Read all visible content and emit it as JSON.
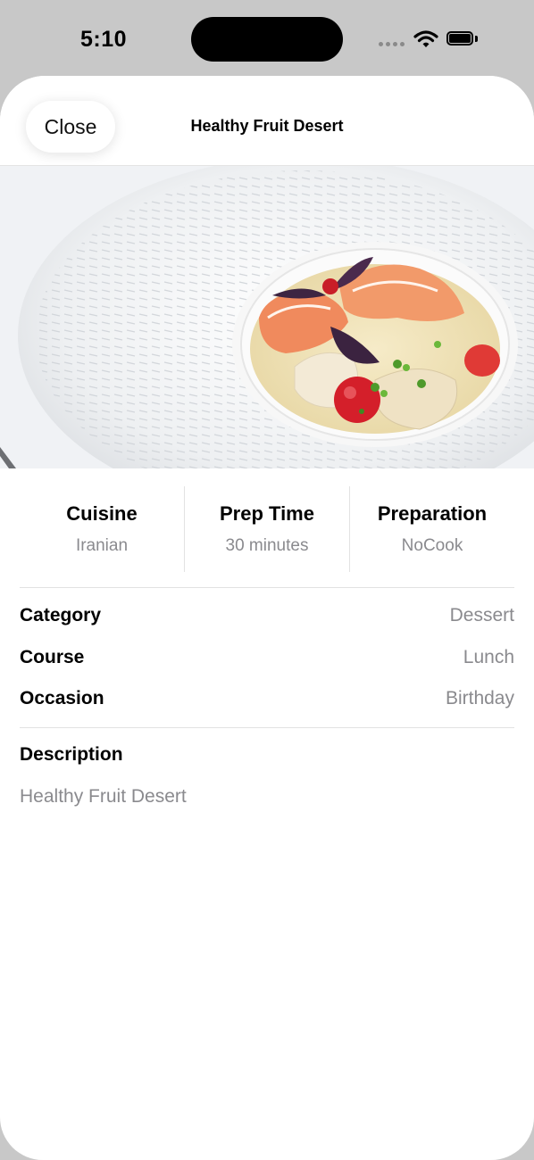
{
  "status_bar": {
    "time": "5:10",
    "icons": [
      "signal-dots-icon",
      "wifi-icon",
      "battery-icon"
    ]
  },
  "nav": {
    "close_label": "Close",
    "title": "Healthy Fruit Desert"
  },
  "stats": [
    {
      "label": "Cuisine",
      "value": "Iranian"
    },
    {
      "label": "Prep Time",
      "value": "30 minutes"
    },
    {
      "label": "Preparation",
      "value": "NoCook"
    }
  ],
  "details": [
    {
      "label": "Category",
      "value": "Dessert"
    },
    {
      "label": "Course",
      "value": "Lunch"
    },
    {
      "label": "Occasion",
      "value": "Birthday"
    }
  ],
  "description": {
    "title": "Description",
    "text": "Healthy Fruit Desert"
  },
  "colors": {
    "background": "#c8c8c8",
    "sheet": "#ffffff",
    "secondary_text": "#8a8a8e",
    "divider": "#e2e2e2"
  }
}
